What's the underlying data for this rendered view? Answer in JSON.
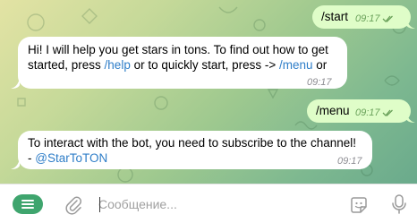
{
  "messages": [
    {
      "direction": "out",
      "text": "/start",
      "time": "09:17",
      "status": "read"
    },
    {
      "direction": "in",
      "line1": "Hi! I will help you get stars in tons. To find out how to get",
      "line2_a": "started, press ",
      "line2_link1": "/help",
      "line2_b": " or to quickly start, press -> ",
      "line2_link2": "/menu",
      "line2_c": " or",
      "time": "09:17"
    },
    {
      "direction": "out",
      "text": "/menu",
      "time": "09:17",
      "status": "read"
    },
    {
      "direction": "in",
      "line1": "To interact with the bot, you need to subscribe to the channel!",
      "line2_a": "- ",
      "line2_link": "@StarToTON",
      "time": "09:17"
    }
  ],
  "composer": {
    "placeholder": "Сообщение...",
    "value": ""
  },
  "icons": {
    "menu": "menu-icon",
    "attach": "paperclip-icon",
    "sticker": "sticker-icon",
    "mic": "microphone-icon"
  },
  "colors": {
    "outgoing_bubble": "#dffdc8",
    "incoming_bubble": "#ffffff",
    "link": "#2f7ec8",
    "menu_button": "#3fa56e",
    "read_check": "#6aa15a"
  }
}
